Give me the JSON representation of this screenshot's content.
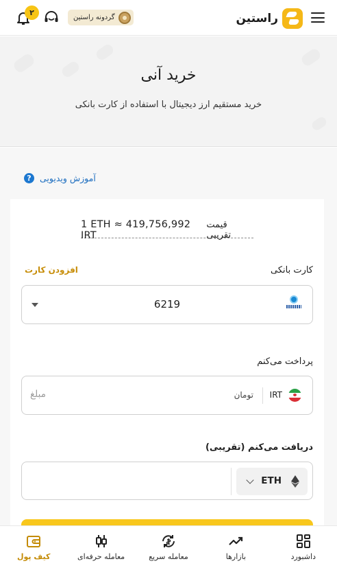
{
  "header": {
    "brand": "راستین",
    "wheel_label": "گردونه راستین",
    "notification_count": "۲"
  },
  "hero": {
    "title": "خرید آنی",
    "subtitle": "خرید مستقیم ارز دیجیتال با استفاده از کارت بانکی"
  },
  "tutorial": {
    "label": "آموزش ویدیویی",
    "icon": "?"
  },
  "price": {
    "label": "قیمت تقریبی",
    "value": "1 ETH ≈ 419,756,992 IRT"
  },
  "bank_card": {
    "label": "کارت بانکی",
    "add_label": "افزودن کارت",
    "selected_card": "6219"
  },
  "pay": {
    "label": "پرداخت می‌کنم",
    "currency_code": "IRT",
    "currency_name": "تومان",
    "amount_placeholder": "مبلغ"
  },
  "receive": {
    "label": "دریافت می‌کنم (تقریبی)",
    "currency_code": "ETH"
  },
  "bottom_nav": [
    {
      "label": "داشبورد",
      "icon": "dashboard-icon"
    },
    {
      "label": "بازارها",
      "icon": "markets-icon"
    },
    {
      "label": "معامله سریع",
      "icon": "quick-trade-icon"
    },
    {
      "label": "معامله حرفه‌ای",
      "icon": "pro-trade-icon"
    },
    {
      "label": "کیف پول",
      "icon": "wallet-icon"
    }
  ],
  "colors": {
    "accent": "#f8c71c",
    "accent_text": "#c48b06",
    "link": "#1f6fc0"
  }
}
